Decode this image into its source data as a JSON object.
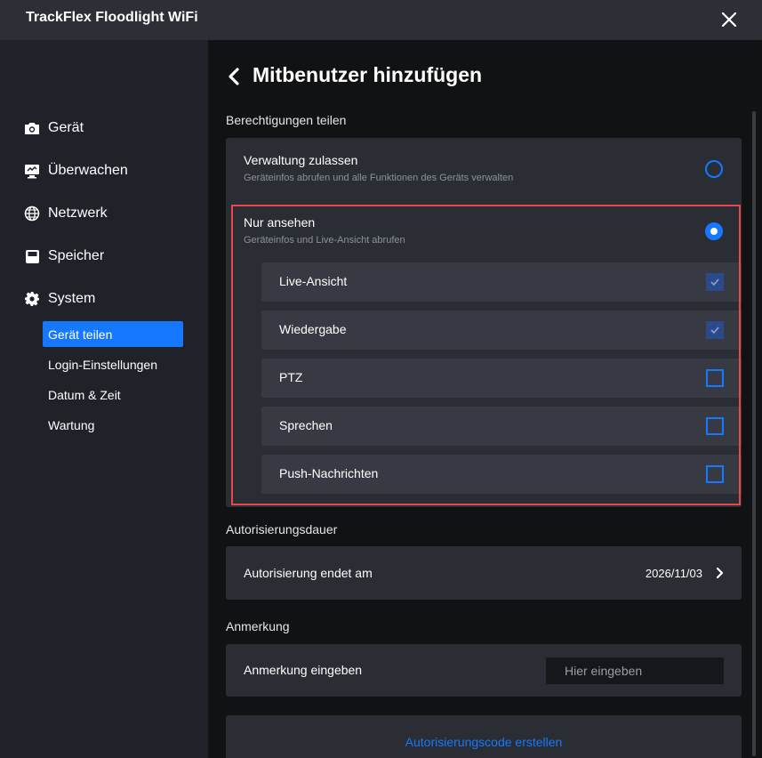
{
  "window": {
    "title": "TrackFlex Floodlight WiFi"
  },
  "sidebar": {
    "items": [
      {
        "label": "Gerät",
        "icon": "camera-icon"
      },
      {
        "label": "Überwachen",
        "icon": "monitor-icon"
      },
      {
        "label": "Netzwerk",
        "icon": "globe-icon"
      },
      {
        "label": "Speicher",
        "icon": "storage-icon"
      },
      {
        "label": "System",
        "icon": "gear-icon"
      }
    ],
    "system_subitems": [
      {
        "label": "Gerät teilen",
        "active": true
      },
      {
        "label": "Login-Einstellungen",
        "active": false
      },
      {
        "label": "Datum & Zeit",
        "active": false
      },
      {
        "label": "Wartung",
        "active": false
      }
    ]
  },
  "main": {
    "page_title": "Mitbenutzer hinzufügen",
    "permissions_section": "Berechtigungen teilen",
    "option_manage": {
      "title": "Verwaltung zulassen",
      "description": "Geräteinfos abrufen und alle Funktionen des Geräts verwalten",
      "selected": false
    },
    "option_view": {
      "title": "Nur ansehen",
      "description": "Geräteinfos und Live-Ansicht abrufen",
      "selected": true
    },
    "permissions": [
      {
        "label": "Live-Ansicht",
        "checked": true
      },
      {
        "label": "Wiedergabe",
        "checked": true
      },
      {
        "label": "PTZ",
        "checked": false
      },
      {
        "label": "Sprechen",
        "checked": false
      },
      {
        "label": "Push-Nachrichten",
        "checked": false
      }
    ],
    "auth_section": "Autorisierungsdauer",
    "auth_row_label": "Autorisierung endet am",
    "auth_end_date": "2026/11/03",
    "note_section": "Anmerkung",
    "note_row_label": "Anmerkung eingeben",
    "note_placeholder": "Hier eingeben",
    "note_value": "",
    "create_code_label": "Autorisierungscode erstellen"
  },
  "colors": {
    "accent": "#1677ff",
    "highlight": "#e5484d",
    "sidebar_bg": "#1f2228",
    "card_bg": "#2a2d34"
  }
}
